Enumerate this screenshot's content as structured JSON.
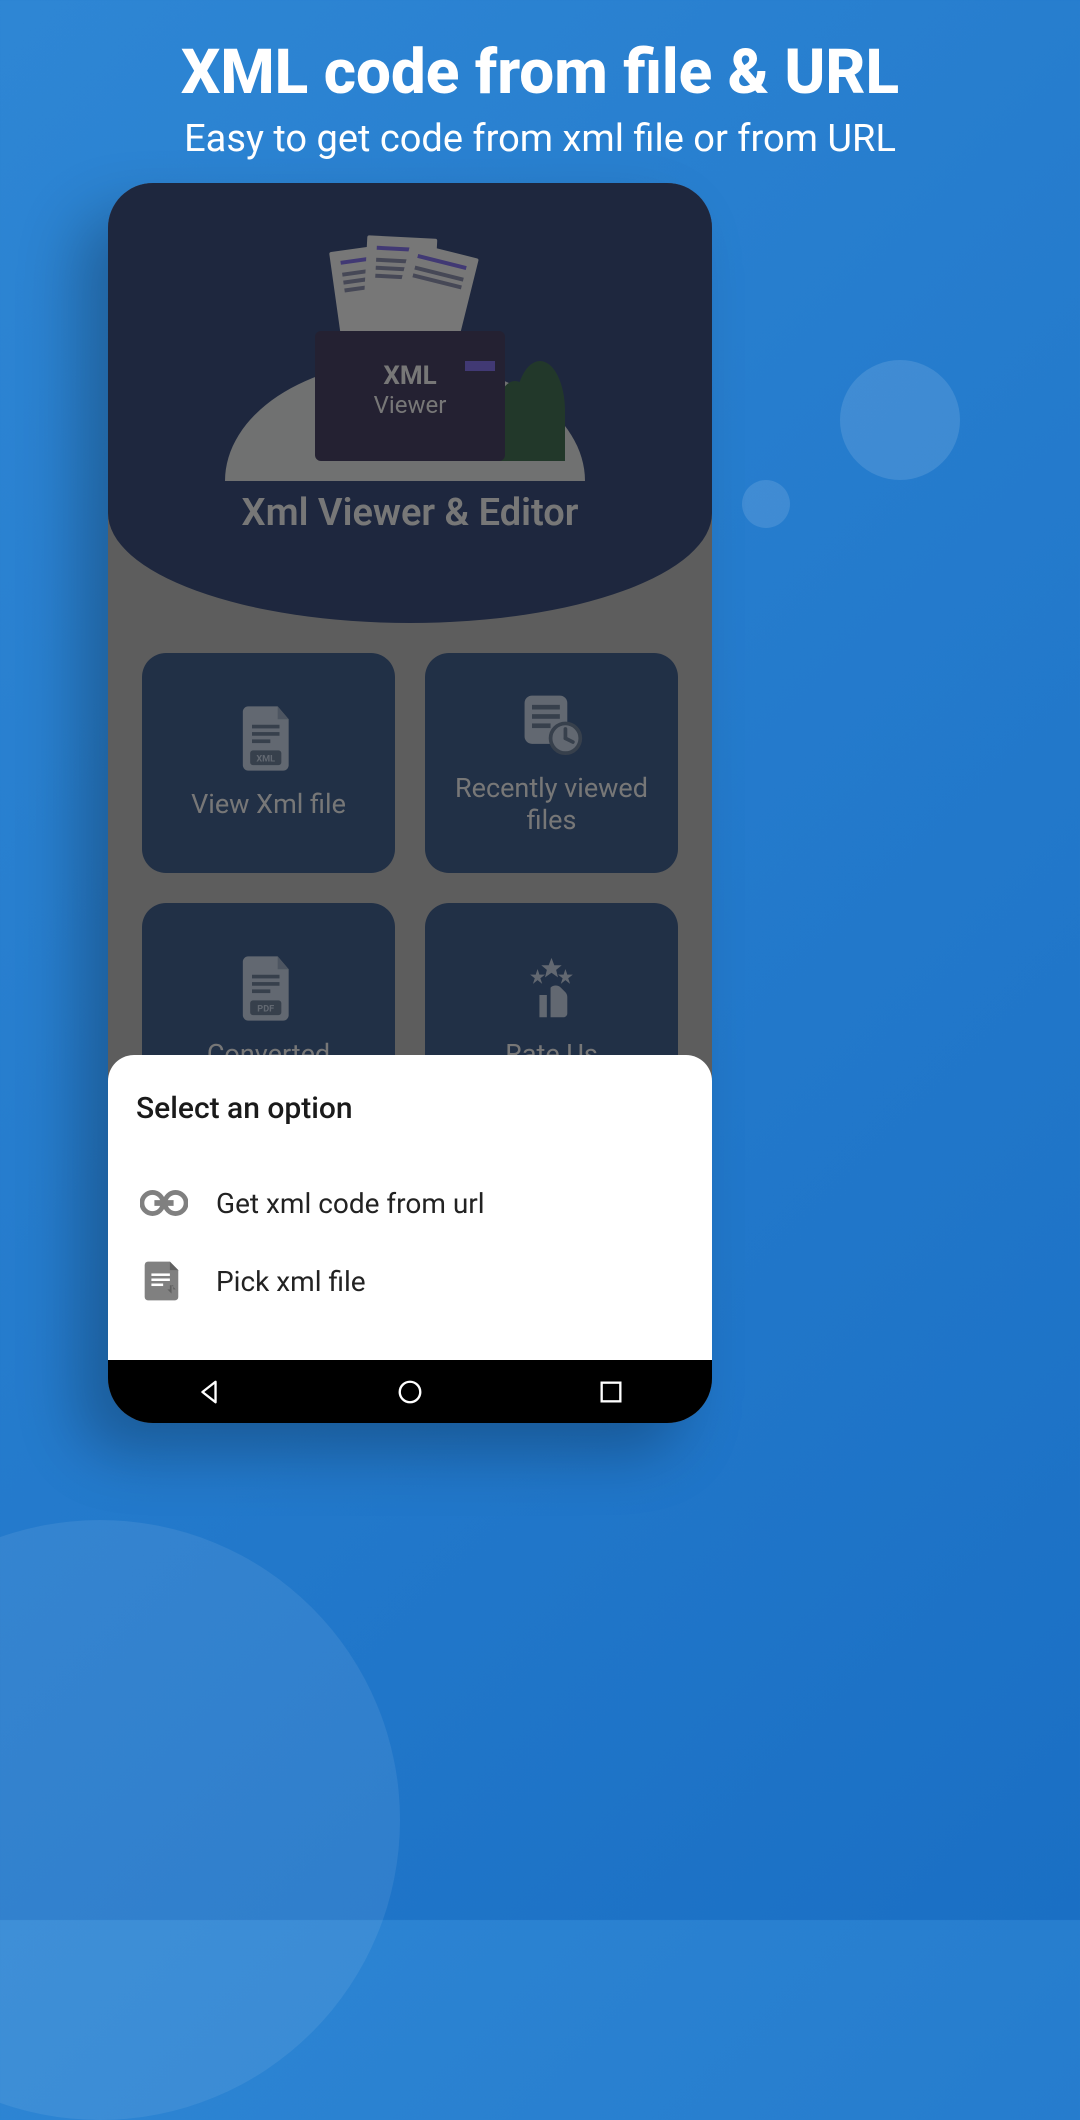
{
  "promo": {
    "title": "XML code from file & URL",
    "subtitle": "Easy to get code from xml file or from URL"
  },
  "app": {
    "title": "Xml Viewer & Editor",
    "hero_folder_line1": "XML",
    "hero_folder_line2": "Viewer",
    "cards": [
      {
        "label": "View Xml file"
      },
      {
        "label": "Recently viewed files"
      },
      {
        "label": "Converted"
      },
      {
        "label": "Rate Us"
      }
    ]
  },
  "sheet": {
    "title": "Select an option",
    "options": [
      {
        "label": "Get xml code from url"
      },
      {
        "label": "Pick xml file"
      }
    ]
  }
}
